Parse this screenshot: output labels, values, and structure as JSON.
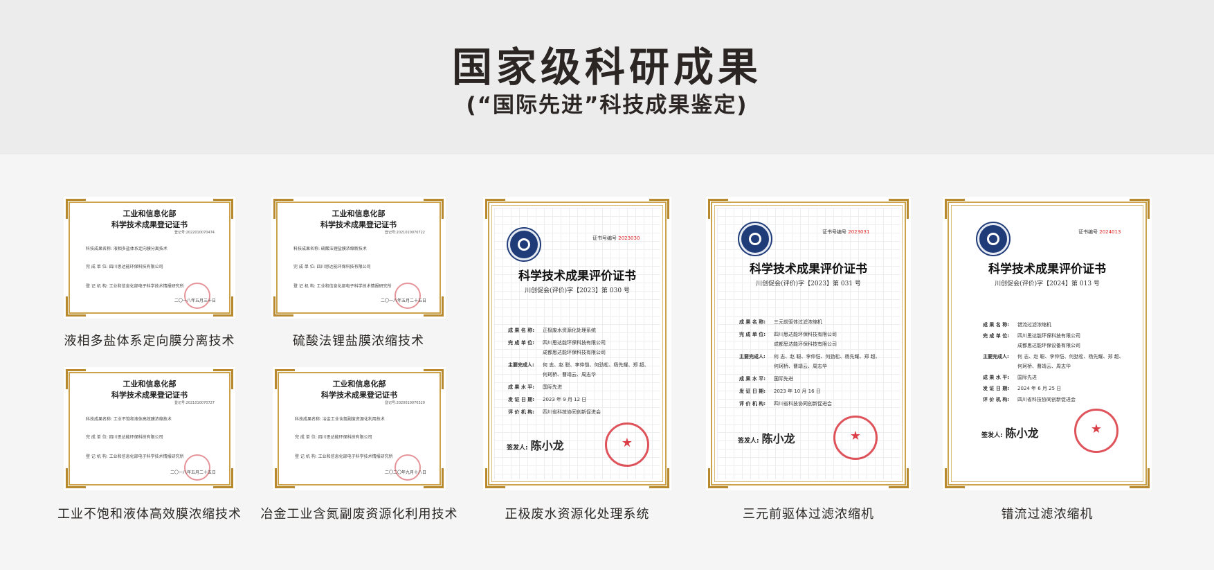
{
  "header": {
    "title": "国家级科研成果",
    "subtitle": "(“国际先进”科技成果鉴定)"
  },
  "landscape_certs": [
    {
      "title1": "工业和信息化部",
      "title2": "科学技术成果登记证书",
      "number": "登记号:2022010070474",
      "lines": [
        "科技成果名称: 液相多盐体系定向膜分离技术",
        "完 成 单 位: 四川思达能环保科技有限公司",
        "登 记 机 构: 工业和信息化部电子科学技术情报研究所"
      ],
      "date": "二〇一八年五月三十日",
      "caption": "液相多盐体系定向膜分离技术"
    },
    {
      "title1": "工业和信息化部",
      "title2": "科学技术成果登记证书",
      "number": "登记号:2021010070722",
      "lines": [
        "科技成果名称: 硫酸法锂盐膜浓缩新技术",
        "完 成 单 位: 四川思达能环保科技有限公司",
        "登 记 机 构: 工业和信息化部电子科学技术情报研究所"
      ],
      "date": "二〇一八年五月二十五日",
      "caption": "硫酸法锂盐膜浓缩技术"
    },
    {
      "title1": "工业和信息化部",
      "title2": "科学技术成果登记证书",
      "number": "登记号:2021010070727",
      "lines": [
        "科技成果名称: 工业不饱和液体高效膜浓缩技术",
        "完 成 单 位: 四川思达能环保科技有限公司",
        "登 记 机 构: 工业和信息化部电子科学技术情报研究所"
      ],
      "date": "二〇一八年五月二十五日",
      "caption": "工业不饱和液体高效膜浓缩技术"
    },
    {
      "title1": "工业和信息化部",
      "title2": "科学技术成果登记证书",
      "number": "登记号:2020010070320",
      "lines": [
        "科技成果名称: 冶金工业含氮副废资源化利用技术",
        "完 成 单 位: 四川思达能环保科技有限公司",
        "登 记 机 构: 工业和信息化部电子科学技术情报研究所"
      ],
      "date": "二〇二〇年九月十八日",
      "caption": "冶金工业含氮副废资源化利用技术"
    }
  ],
  "portrait_certs": [
    {
      "cert_no_label": "证书号编号",
      "cert_no": "2023030",
      "title": "科学技术成果评价证书",
      "sub": "川创促会(评价)字【2023】第 030 号",
      "fields": [
        {
          "k": "成 果 名 称:",
          "v": "正极废水资源化处理系统"
        },
        {
          "k": "完 成 单 位:",
          "v": "四川思达能环保科技有限公司"
        },
        {
          "k": "",
          "v": "成都思达能环保科技有限公司"
        },
        {
          "k": "主要完成人:",
          "v": "何 志、赵 聪、李仲恺、何劲松、杨先耀、郑 超、"
        },
        {
          "k": "",
          "v": "何珂桥、曹靖云、周志华"
        },
        {
          "k": "成 果 水 平:",
          "v": "国际先进"
        },
        {
          "k": "发 证 日 期:",
          "v": "2023 年 9 月 12 日"
        },
        {
          "k": "评 价 机 构:",
          "v": "四川省科技协同创新促进会"
        }
      ],
      "signer": "签发人:",
      "signature": "陈小龙",
      "caption": "正极废水资源化处理系统"
    },
    {
      "cert_no_label": "证书号编号",
      "cert_no": "2023031",
      "title": "科学技术成果评价证书",
      "sub": "川创促会(评价)字【2023】第 031 号",
      "fields": [
        {
          "k": "成 果 名 称:",
          "v": "三元前驱体过滤浓缩机"
        },
        {
          "k": "完 成 单 位:",
          "v": "四川思达能环保科技有限公司"
        },
        {
          "k": "",
          "v": "成都思达能环保科技有限公司"
        },
        {
          "k": "主要完成人:",
          "v": "何 志、赵 聪、李仲恺、何劲松、杨先耀、郑 超、"
        },
        {
          "k": "",
          "v": "何珂桥、曹靖云、周志华"
        },
        {
          "k": "成 果 水 平:",
          "v": "国际先进"
        },
        {
          "k": "发 证 日 期:",
          "v": "2023 年 10 月 16 日"
        },
        {
          "k": "评 价 机 构:",
          "v": "四川省科技协同创新促进会"
        }
      ],
      "signer": "签发人:",
      "signature": "陈小龙",
      "caption": "三元前驱体过滤浓缩机"
    },
    {
      "cert_no_label": "证书编号",
      "cert_no": "2024013",
      "title": "科学技术成果评价证书",
      "sub": "川创促会(评价)字【2024】第 013 号",
      "fields": [
        {
          "k": "成 果 名 称:",
          "v": "错流过滤浓缩机"
        },
        {
          "k": "完 成 单 位:",
          "v": "四川思达能环保科技有限公司"
        },
        {
          "k": "",
          "v": "成都思达能环保设备有限公司"
        },
        {
          "k": "主要完成人:",
          "v": "何 志、赵 聪、李仲恺、何劲松、杨先耀、郑 超、"
        },
        {
          "k": "",
          "v": "何珂桥、曹靖云、周志华"
        },
        {
          "k": "成 果 水 平:",
          "v": "国际先进"
        },
        {
          "k": "发 证 日 期:",
          "v": "2024 年 6 月 25 日"
        },
        {
          "k": "评 价 机 构:",
          "v": "四川省科技协同创新促进会"
        }
      ],
      "signer": "签发人:",
      "signature": "陈小龙",
      "caption": "错流过滤浓缩机"
    }
  ]
}
